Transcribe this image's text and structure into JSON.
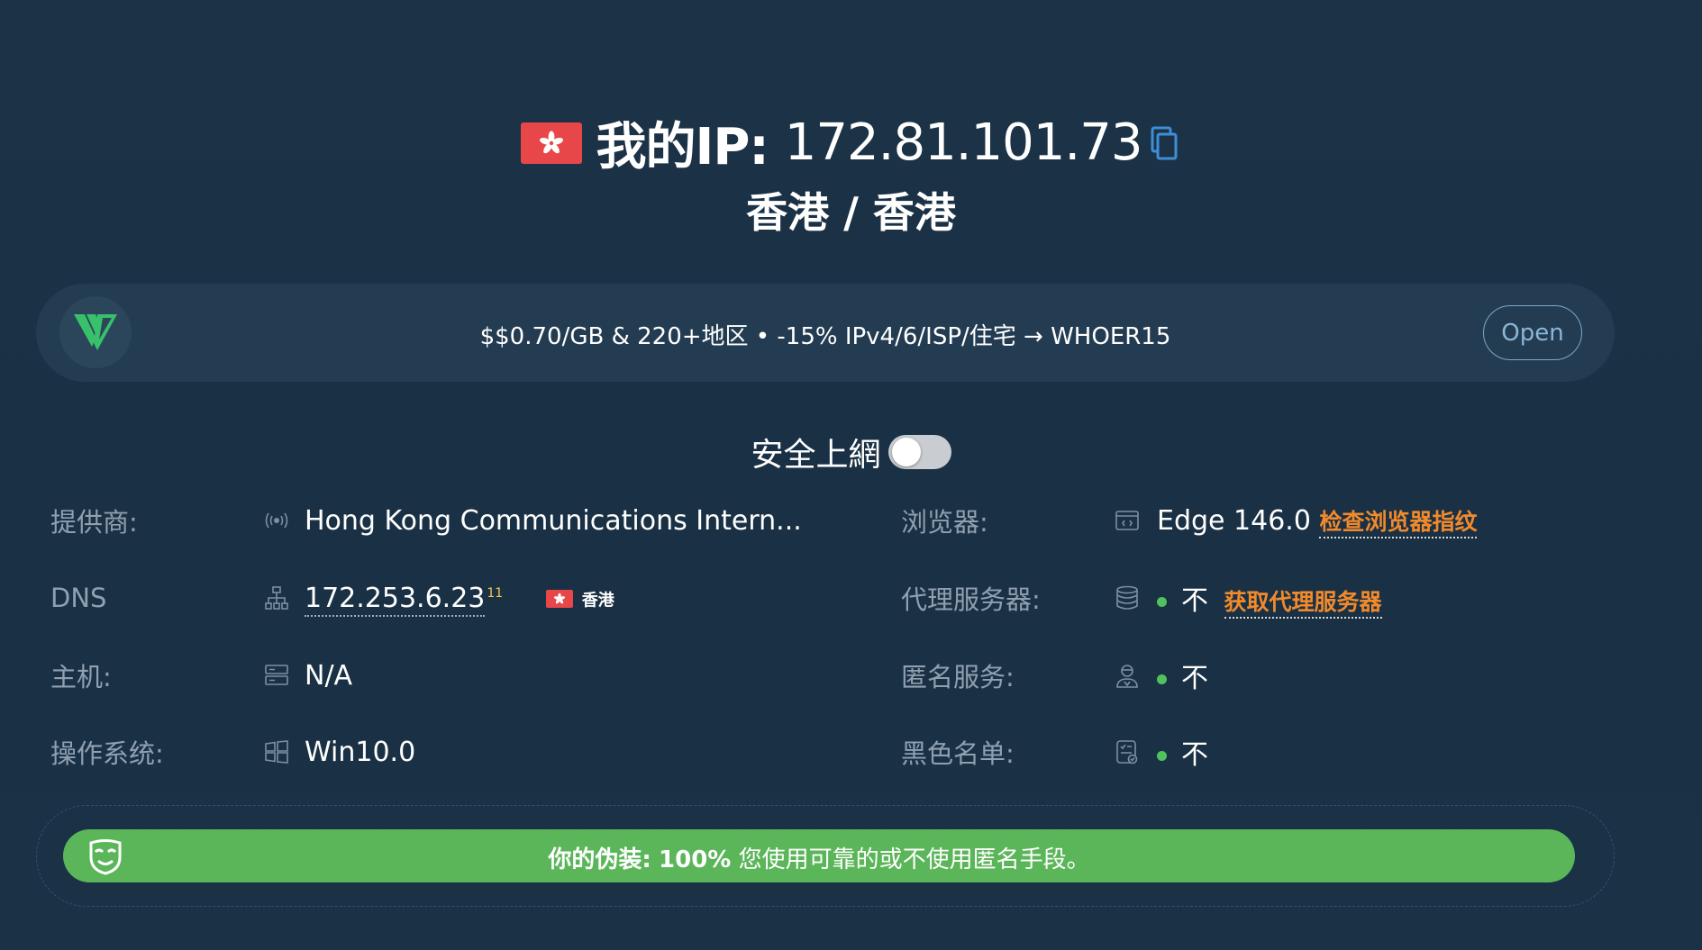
{
  "header": {
    "ip_label": "我的IP:",
    "ip_address": "172.81.101.73",
    "location": "香港 / 香港"
  },
  "banner": {
    "text": "$$0.70/GB & 220+地区 • -15% IPv4/6/ISP/住宅 → WHOER15",
    "open_label": "Open"
  },
  "secure": {
    "label": "安全上網",
    "enabled": false
  },
  "info": {
    "provider": {
      "label": "提供商:",
      "value": "Hong Kong Communications Intern..."
    },
    "dns": {
      "label": "DNS",
      "value": "172.253.6.23",
      "count": "11",
      "country": "香港"
    },
    "host": {
      "label": "主机:",
      "value": "N/A"
    },
    "os": {
      "label": "操作系统:",
      "value": "Win10.0"
    },
    "browser": {
      "label": "浏览器:",
      "value": "Edge 146.0",
      "link": "检查浏览器指纹"
    },
    "proxy": {
      "label": "代理服务器:",
      "value": "不",
      "link": "获取代理服务器"
    },
    "anonymizer": {
      "label": "匿名服务:",
      "value": "不"
    },
    "blacklist": {
      "label": "黑色名单:",
      "value": "不"
    }
  },
  "disguise": {
    "label": "你的伪装:",
    "percent": "100%",
    "message": "您使用可靠的或不使用匿名手段。"
  },
  "colors": {
    "background": "#1c3247",
    "flag_red": "#e8474a",
    "status_green": "#4fc25d",
    "bar_green": "#5bb65a",
    "link_orange": "#f08a2c"
  }
}
